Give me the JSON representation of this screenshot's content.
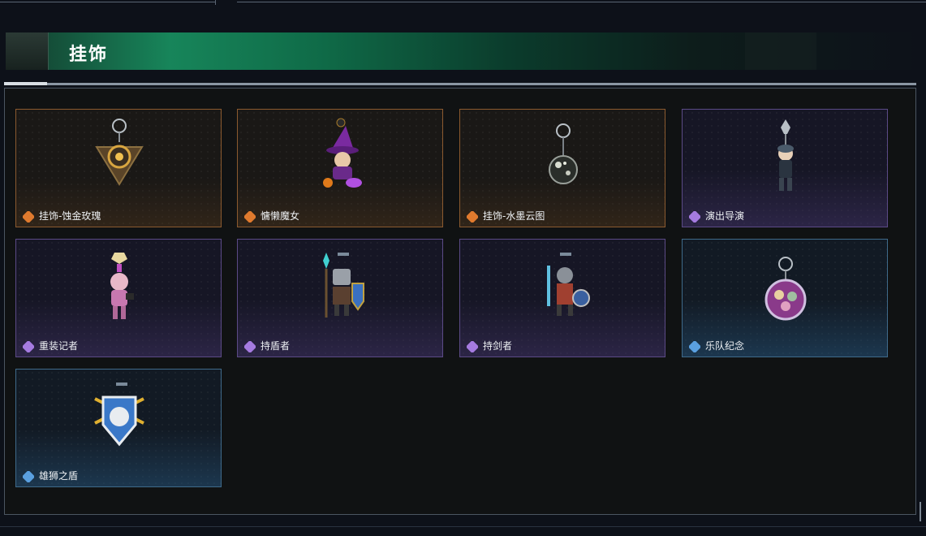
{
  "header": {
    "title": "挂饰"
  },
  "items": [
    {
      "label": "挂饰-蚀金玫瑰",
      "rarity": "orange",
      "icon": "rose-charm-icon"
    },
    {
      "label": "慵懒魔女",
      "rarity": "orange",
      "icon": "witch-charm-icon"
    },
    {
      "label": "挂饰-水墨云图",
      "rarity": "orange",
      "icon": "ink-orb-charm-icon"
    },
    {
      "label": "演出导演",
      "rarity": "purple",
      "icon": "director-charm-icon"
    },
    {
      "label": "重装记者",
      "rarity": "purple",
      "icon": "reporter-charm-icon"
    },
    {
      "label": "持盾者",
      "rarity": "purple",
      "icon": "shield-knight-charm-icon"
    },
    {
      "label": "持剑者",
      "rarity": "purple",
      "icon": "sword-knight-charm-icon"
    },
    {
      "label": "乐队纪念",
      "rarity": "blue",
      "icon": "band-badge-charm-icon"
    },
    {
      "label": "雄狮之盾",
      "rarity": "blue",
      "icon": "lion-shield-charm-icon"
    }
  ],
  "colors": {
    "orange": "#e07a2e",
    "purple": "#a57be0",
    "blue": "#5aa0e0",
    "accent_green": "#17855a"
  }
}
